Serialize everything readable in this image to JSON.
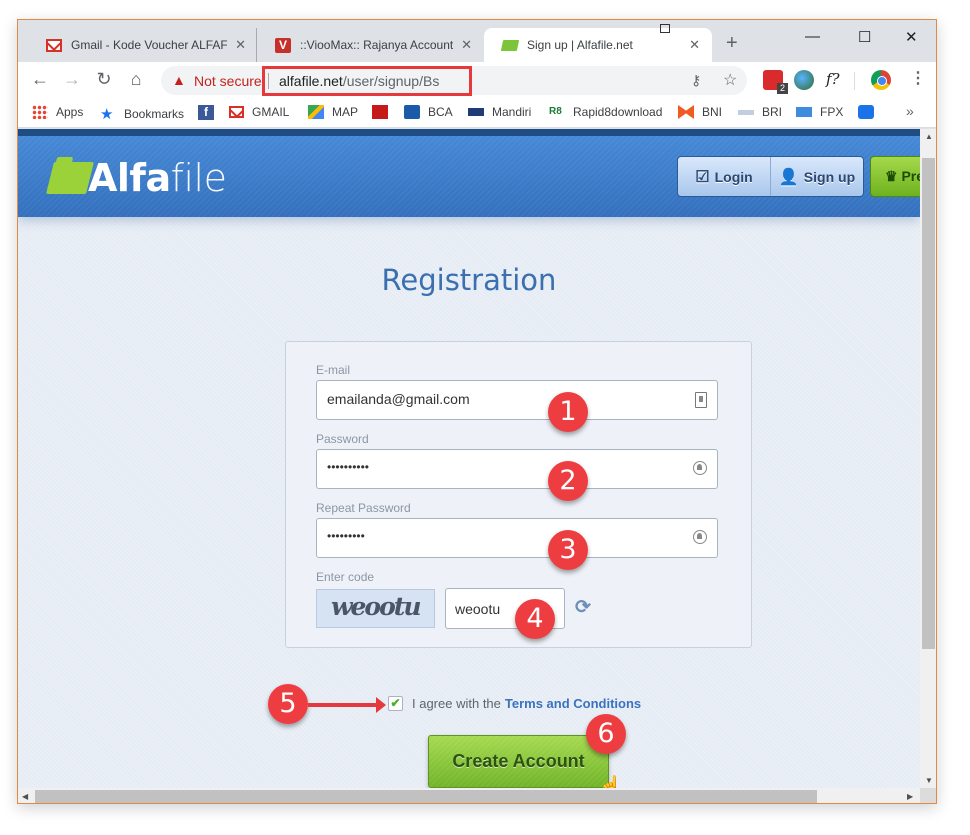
{
  "browser": {
    "tabs": [
      {
        "title": "Gmail - Kode Voucher ALFAFILE",
        "icon": "gmail-icon",
        "active": false
      },
      {
        "title": "::ViooMax:: Rajanya Account Premium",
        "icon": "vioomax-icon",
        "active": false
      },
      {
        "title": "Sign up | Alfafile.net",
        "icon": "folder-icon",
        "active": true
      }
    ],
    "new_tab": "+",
    "window_controls": {
      "minimize": "—",
      "maximize": "☐",
      "close": "✕"
    },
    "tab_close": "✕",
    "nav": {
      "back": "←",
      "forward": "→",
      "reload": "↻",
      "home": "⌂"
    },
    "security_label": "Not secure",
    "url_host": "alfafile.net",
    "url_path": "/user/signup/Bs",
    "omnibox_icons": {
      "key": "⚷",
      "star": "☆"
    },
    "extensions": [
      {
        "name": "lastpass-icon",
        "badge": "2"
      },
      {
        "name": "idm-icon"
      },
      {
        "name": "font-identifier-icon",
        "label": "f?"
      },
      {
        "name": "chrome-extension-icon"
      }
    ],
    "menu": "⋮",
    "bookmarks": [
      {
        "label": "Apps",
        "icon": "apps-icon"
      },
      {
        "label": "Bookmarks",
        "icon": "star-icon"
      },
      {
        "label": "",
        "icon": "facebook-icon"
      },
      {
        "label": "GMAIL",
        "icon": "gmail-icon"
      },
      {
        "label": "MAP",
        "icon": "maps-icon"
      },
      {
        "label": "",
        "icon": "lm-icon"
      },
      {
        "label": "BCA",
        "icon": "bca-icon"
      },
      {
        "label": "Mandiri",
        "icon": "mandiri-icon"
      },
      {
        "label": "Rapid8download",
        "icon": "r8-icon"
      },
      {
        "label": "BNI",
        "icon": "bni-icon"
      },
      {
        "label": "BRI",
        "icon": "bri-icon"
      },
      {
        "label": "FPX",
        "icon": "fpx-icon"
      },
      {
        "label": "",
        "icon": "c-icon"
      }
    ],
    "bookmarks_more": "»"
  },
  "site": {
    "logo_bold": "Alfa",
    "logo_light": "file",
    "login_label": "Login",
    "signup_label": "Sign up",
    "premium_label": "Premium",
    "title": "Registration",
    "form": {
      "email_label": "E-mail",
      "email_value": "emailanda@gmail.com",
      "password_label": "Password",
      "password_value": "••••••••••",
      "repeat_label": "Repeat Password",
      "repeat_value": "•••••••••",
      "code_label": "Enter code",
      "captcha_text": "weootu",
      "code_value": "weootu",
      "refresh": "⟳"
    },
    "agree_text": "I agree with the",
    "terms_link": "Terms and Conditions",
    "agree_checked": true,
    "checkmark": "✔",
    "create_button": "Create Account"
  },
  "annotations": [
    "1",
    "2",
    "3",
    "4",
    "5",
    "6"
  ],
  "colors": {
    "header_blue": "#3d7cc8",
    "accent_green": "#8cc63f",
    "marker_red": "#ee3d40",
    "title_blue": "#3a6fb0"
  }
}
